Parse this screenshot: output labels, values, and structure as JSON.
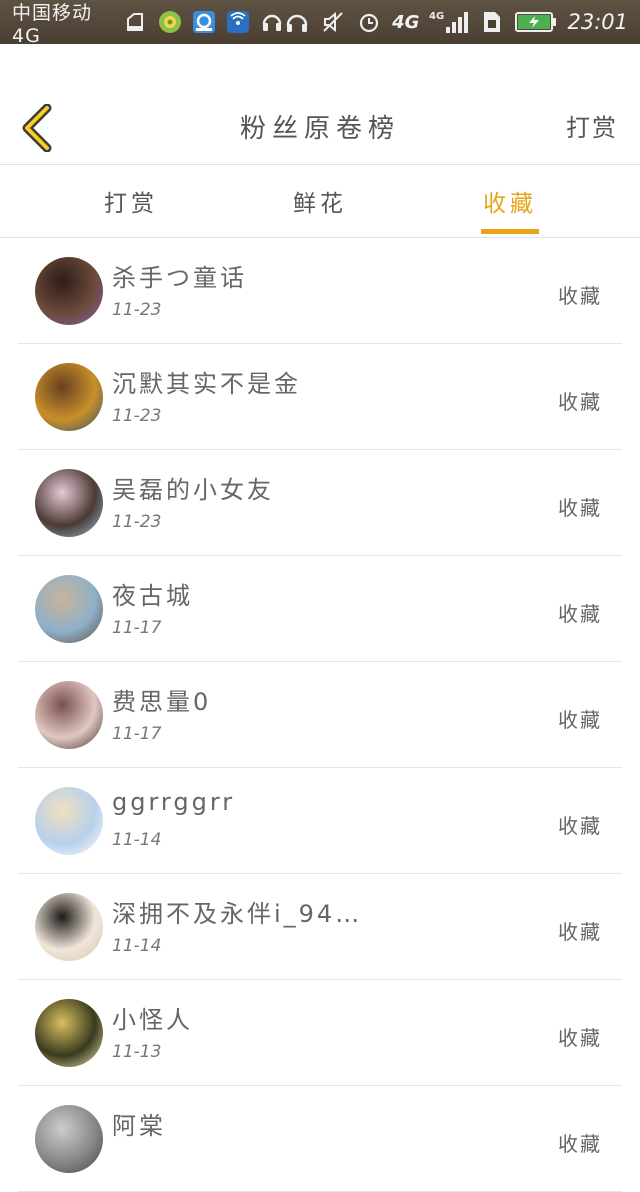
{
  "status_bar": {
    "carrier": "中国移动4G",
    "net1": "4G",
    "net2": "4G",
    "time": "23:01",
    "left_icons": [
      "sd-card-icon",
      "music-app-icon",
      "app-store-icon",
      "wifi-hotspot-icon",
      "headset-icon"
    ],
    "right_icons": [
      "headphones-icon",
      "mute-icon",
      "alarm-icon",
      "signal-icon",
      "sim-icon",
      "battery-icon"
    ]
  },
  "header": {
    "title": "粉丝原卷榜",
    "action": "打赏"
  },
  "tabs": [
    {
      "label": "打赏",
      "active": false
    },
    {
      "label": "鲜花",
      "active": false
    },
    {
      "label": "收藏",
      "active": true
    }
  ],
  "colors": {
    "accent": "#e8a319",
    "status_bar": "#4f4437"
  },
  "items": [
    {
      "name": "杀手つ童话",
      "date": "11-23",
      "action": "收藏",
      "avatar_colors": [
        "#6b4a3a",
        "#2d1d18",
        "#8a5fb0"
      ]
    },
    {
      "name": "沉默其实不是金",
      "date": "11-23",
      "action": "收藏",
      "avatar_colors": [
        "#c8902a",
        "#6a4020",
        "#2e4a6a"
      ]
    },
    {
      "name": "吴磊的小女友",
      "date": "11-23",
      "action": "收藏",
      "avatar_colors": [
        "#4a3a32",
        "#e8c8d8",
        "#9fc4e8"
      ]
    },
    {
      "name": "夜古城",
      "date": "11-17",
      "action": "收藏",
      "avatar_colors": [
        "#8fb0c8",
        "#c9b39a",
        "#5a4a40"
      ]
    },
    {
      "name": "费思量0",
      "date": "11-17",
      "action": "收藏",
      "avatar_colors": [
        "#e0c8c0",
        "#7a5050",
        "#3a2a2a"
      ]
    },
    {
      "name": "ggrrggrr",
      "date": "11-14",
      "action": "收藏",
      "avatar_colors": [
        "#b8d0ec",
        "#f0e0c0",
        "#ffffff"
      ]
    },
    {
      "name": "深拥不及永伴i_94…",
      "date": "11-14",
      "action": "收藏",
      "avatar_colors": [
        "#f0e6da",
        "#1e1a18",
        "#d8c2a8"
      ]
    },
    {
      "name": "小怪人",
      "date": "11-13",
      "action": "收藏",
      "avatar_colors": [
        "#3a3a20",
        "#d8c060",
        "#f8f0b0"
      ]
    },
    {
      "name": "阿棠",
      "date": "",
      "action": "收藏",
      "avatar_colors": [
        "#888888",
        "#cccccc",
        "#444444"
      ]
    }
  ]
}
